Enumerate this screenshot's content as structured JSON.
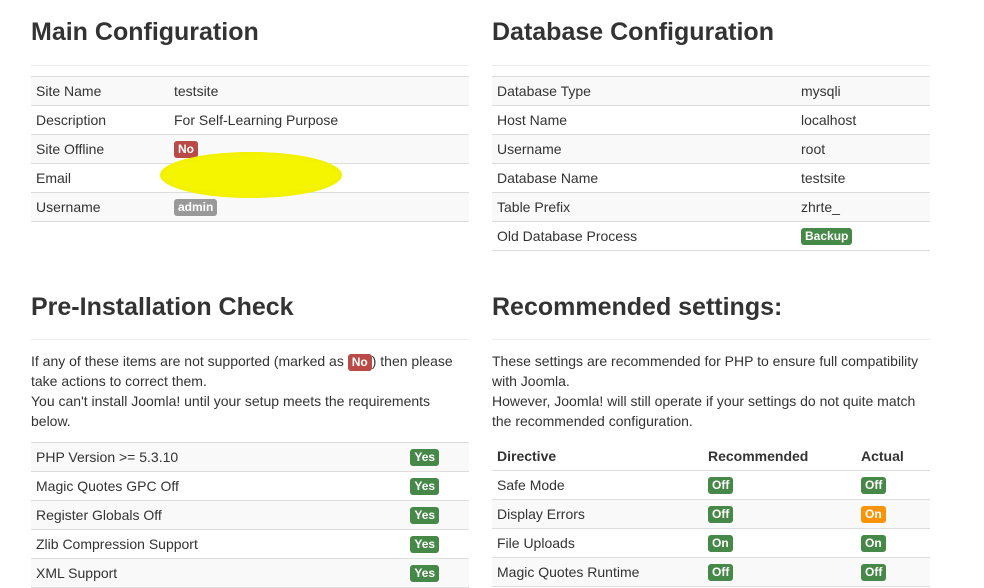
{
  "main_config": {
    "title": "Main Configuration",
    "rows": [
      {
        "label": "Site Name",
        "value": "testsite"
      },
      {
        "label": "Description",
        "value": "For Self-Learning Purpose"
      },
      {
        "label": "Site Offline",
        "badge": "No"
      },
      {
        "label": "Email",
        "value": ""
      },
      {
        "label": "Username",
        "badge": "admin"
      }
    ]
  },
  "db_config": {
    "title": "Database Configuration",
    "rows": [
      {
        "label": "Database Type",
        "value": "mysqli"
      },
      {
        "label": "Host Name",
        "value": "localhost"
      },
      {
        "label": "Username",
        "value": "root"
      },
      {
        "label": "Database Name",
        "value": "testsite"
      },
      {
        "label": "Table Prefix",
        "value": "zhrte_"
      },
      {
        "label": "Old Database Process",
        "badge": "Backup"
      }
    ]
  },
  "pre_install": {
    "title": "Pre-Installation Check",
    "note_before": "If any of these items are not supported (marked as ",
    "note_badge": "No",
    "note_after": ") then please take actions to correct them.",
    "note_line2": "You can't install Joomla! until your setup meets the requirements below.",
    "items": [
      {
        "label": "PHP Version >= 5.3.10",
        "status": "Yes"
      },
      {
        "label": "Magic Quotes GPC Off",
        "status": "Yes"
      },
      {
        "label": "Register Globals Off",
        "status": "Yes"
      },
      {
        "label": "Zlib Compression Support",
        "status": "Yes"
      },
      {
        "label": "XML Support",
        "status": "Yes"
      }
    ]
  },
  "recommended": {
    "title": "Recommended settings:",
    "note_line1": "These settings are recommended for PHP to ensure full compatibility with Joomla.",
    "note_line2": "However, Joomla! will still operate if your settings do not quite match the recommended configuration.",
    "headers": {
      "directive": "Directive",
      "recommended": "Recommended",
      "actual": "Actual"
    },
    "rows": [
      {
        "directive": "Safe Mode",
        "recommended": "Off",
        "actual": "Off"
      },
      {
        "directive": "Display Errors",
        "recommended": "Off",
        "actual": "On"
      },
      {
        "directive": "File Uploads",
        "recommended": "On",
        "actual": "On"
      },
      {
        "directive": "Magic Quotes Runtime",
        "recommended": "Off",
        "actual": "Off"
      }
    ]
  },
  "colors": {
    "badge_red": "#b94a48",
    "badge_green": "#468847",
    "badge_grey": "#999999",
    "badge_orange": "#f89406"
  }
}
